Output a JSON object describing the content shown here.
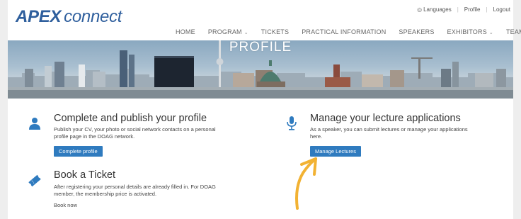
{
  "header": {
    "logo_apex": "APEX",
    "logo_connect": "connect",
    "util_nav": {
      "languages": "Languages",
      "profile": "Profile",
      "logout": "Logout"
    },
    "nav": [
      {
        "label": "HOME"
      },
      {
        "label": "PROGRAM",
        "dropdown": true
      },
      {
        "label": "TICKETS"
      },
      {
        "label": "PRACTICAL INFORMATION"
      },
      {
        "label": "SPEAKERS"
      },
      {
        "label": "EXHIBITORS",
        "dropdown": true
      },
      {
        "label": "TEAM"
      }
    ]
  },
  "banner": {
    "title": "PROFILE"
  },
  "cards": {
    "profile": {
      "icon": "user-icon",
      "title": "Complete and publish your profile",
      "desc_line1": "Publish your CV, your photo or social network contacts on a personal",
      "desc_line2": "profile page in the DOAG network.",
      "button": "Complete profile"
    },
    "lectures": {
      "icon": "microphone-icon",
      "title": "Manage your lecture applications",
      "desc_line1": "As a speaker, you can submit lectures or manage your applications",
      "desc_line2": "here.",
      "button": "Manage Lectures"
    },
    "ticket": {
      "icon": "ticket-icon",
      "title": "Book a Ticket",
      "desc_line1": "After registering your personal details are already filled in. For DOAG",
      "desc_line2": "member, the membership price is activated.",
      "link": "Book now"
    }
  },
  "colors": {
    "brand": "#2f5f9d",
    "accent": "#2f7bbf",
    "annotation_arrow": "#f2b233"
  }
}
